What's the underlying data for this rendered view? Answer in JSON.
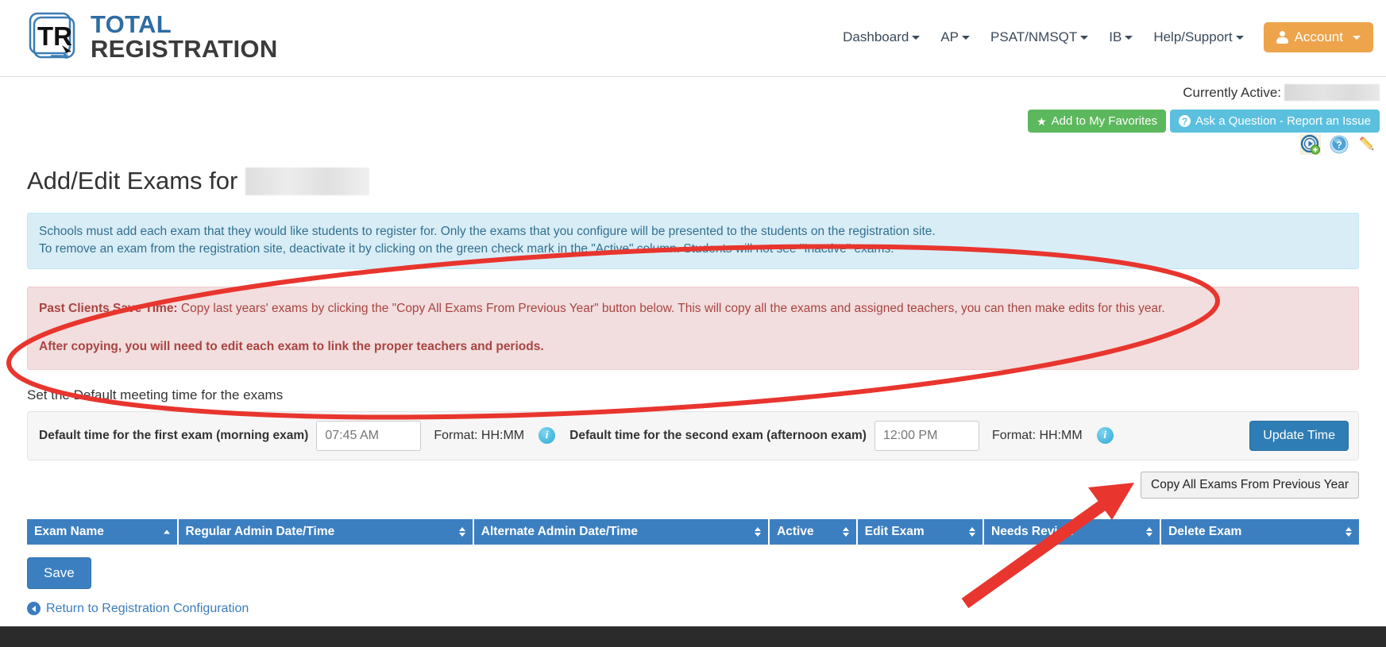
{
  "brand": {
    "line1": "TOTAL",
    "line2": "REGISTRATION",
    "logo_icon": "tr-logo-icon"
  },
  "nav": {
    "items": [
      {
        "label": "Dashboard",
        "caret": true
      },
      {
        "label": "AP",
        "caret": true
      },
      {
        "label": "PSAT/NMSQT",
        "caret": true
      },
      {
        "label": "IB",
        "caret": true
      },
      {
        "label": "Help/Support",
        "caret": true
      }
    ],
    "account": {
      "label": "Account",
      "icon": "user-icon",
      "color": "#eda44b"
    }
  },
  "util": {
    "currently_active_label": "Currently Active:",
    "currently_active_value": "",
    "favorites_button": "Add to My Favorites",
    "favorites_icon": "star-icon",
    "ask_question_button": "Ask a Question - Report an Issue",
    "ask_question_icon": "question-circle-icon",
    "icons": [
      {
        "name": "video-tutorial-icon"
      },
      {
        "name": "help-question-icon"
      },
      {
        "name": "edit-pencil-icon"
      }
    ]
  },
  "main": {
    "title_prefix": "Add/Edit Exams for",
    "title_value": "",
    "info_alert": {
      "line1": "Schools must add each exam that they would like students to register for. Only the exams that you configure will be presented to the students on the registration site.",
      "line2": "To remove an exam from the registration site, deactivate it by clicking on the green check mark in the \"Active\" column. Students will not see \"Inactive\" exams."
    },
    "danger_alert": {
      "bold_lead": "Past Clients Save Time:",
      "line1": " Copy last years' exams by clicking the \"Copy All Exams From Previous Year\" button below. This will copy all the exams and assigned teachers, you can then make edits for this year.",
      "line2": "After copying, you will need to edit each exam to link the proper teachers and periods."
    },
    "default_time_label": "Set the Default meeting time for the exams",
    "time_panel": {
      "first_label": "Default time for the first exam (morning exam)",
      "first_value": "",
      "first_placeholder": "07:45 AM",
      "first_format": "Format: HH:MM",
      "second_label": "Default time for the second exam (afternoon exam)",
      "second_value": "",
      "second_placeholder": "12:00 PM",
      "second_format": "Format: HH:MM",
      "info_icon": "info-circle-icon",
      "update_button": "Update Time"
    },
    "copy_button": "Copy All Exams From Previous Year",
    "table": {
      "columns": [
        {
          "label": "Exam Name",
          "sort": "asc"
        },
        {
          "label": "Regular Admin Date/Time",
          "sort": "none"
        },
        {
          "label": "Alternate Admin Date/Time",
          "sort": "none"
        },
        {
          "label": "Active",
          "sort": "none"
        },
        {
          "label": "Edit Exam",
          "sort": "none"
        },
        {
          "label": "Needs Review",
          "sort": "none"
        },
        {
          "label": "Delete Exam",
          "sort": "none"
        }
      ],
      "rows": []
    },
    "save_button": "Save",
    "return_link": "Return to Registration Configuration",
    "return_icon": "back-circle-icon"
  },
  "annotations": {
    "ellipse": {
      "name": "red-ellipse-highlight",
      "color": "#e8352e"
    },
    "arrow": {
      "name": "red-arrow-pointer",
      "color": "#e8352e"
    }
  },
  "colors": {
    "brand_blue": "#2f6ca3",
    "accent_orange": "#eda44b",
    "table_header_blue": "#3c7fc0",
    "info_bg": "#d9edf7",
    "danger_bg": "#f2dede",
    "annotation_red": "#e8352e"
  }
}
